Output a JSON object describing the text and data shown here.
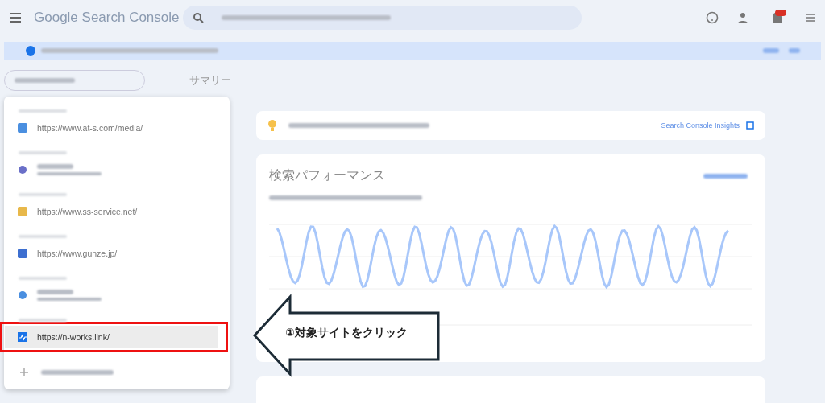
{
  "header": {
    "logo": "Google Search Console"
  },
  "page_title": "サマリー",
  "properties": [
    {
      "kind": "url",
      "url": "https://www.at-s.com/media/",
      "selected": false
    },
    {
      "kind": "domain",
      "selected": false
    },
    {
      "kind": "url",
      "url": "https://www.ss-service.net/",
      "selected": false
    },
    {
      "kind": "url",
      "url": "https://www.gunze.jp/",
      "selected": false
    },
    {
      "kind": "domain",
      "selected": false
    },
    {
      "kind": "url",
      "url": "https://n-works.link/",
      "selected": true
    }
  ],
  "insights_card": {
    "link": "Search Console Insights"
  },
  "performance_card": {
    "title": "検索パフォーマンス"
  },
  "callout": {
    "text": "①対象サイトをクリック"
  }
}
